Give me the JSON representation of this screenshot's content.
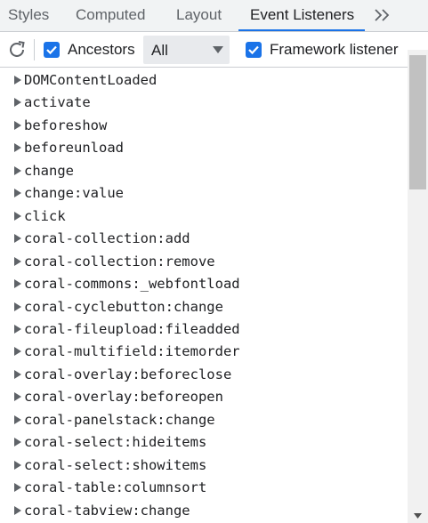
{
  "tabs": [
    {
      "label": "Styles",
      "active": false
    },
    {
      "label": "Computed",
      "active": false
    },
    {
      "label": "Layout",
      "active": false
    },
    {
      "label": "Event Listeners",
      "active": true
    }
  ],
  "more_tabs_icon": "chevron-double-right-icon",
  "toolbar": {
    "refresh_icon": "refresh-icon",
    "ancestors": {
      "label": "Ancestors",
      "checked": true
    },
    "filter_select": {
      "value": "All"
    },
    "framework": {
      "label": "Framework listener",
      "checked": true
    }
  },
  "colors": {
    "accent": "#1a73e8",
    "tabbar_bg": "#f1f3f4",
    "select_bg": "#e8eaed",
    "scroll_thumb": "#c1c1c1"
  },
  "events": [
    "DOMContentLoaded",
    "activate",
    "beforeshow",
    "beforeunload",
    "change",
    "change:value",
    "click",
    "coral-collection:add",
    "coral-collection:remove",
    "coral-commons:_webfontload",
    "coral-cyclebutton:change",
    "coral-fileupload:fileadded",
    "coral-multifield:itemorder",
    "coral-overlay:beforeclose",
    "coral-overlay:beforeopen",
    "coral-panelstack:change",
    "coral-select:hideitems",
    "coral-select:showitems",
    "coral-table:columnsort",
    "coral-tabview:change"
  ]
}
